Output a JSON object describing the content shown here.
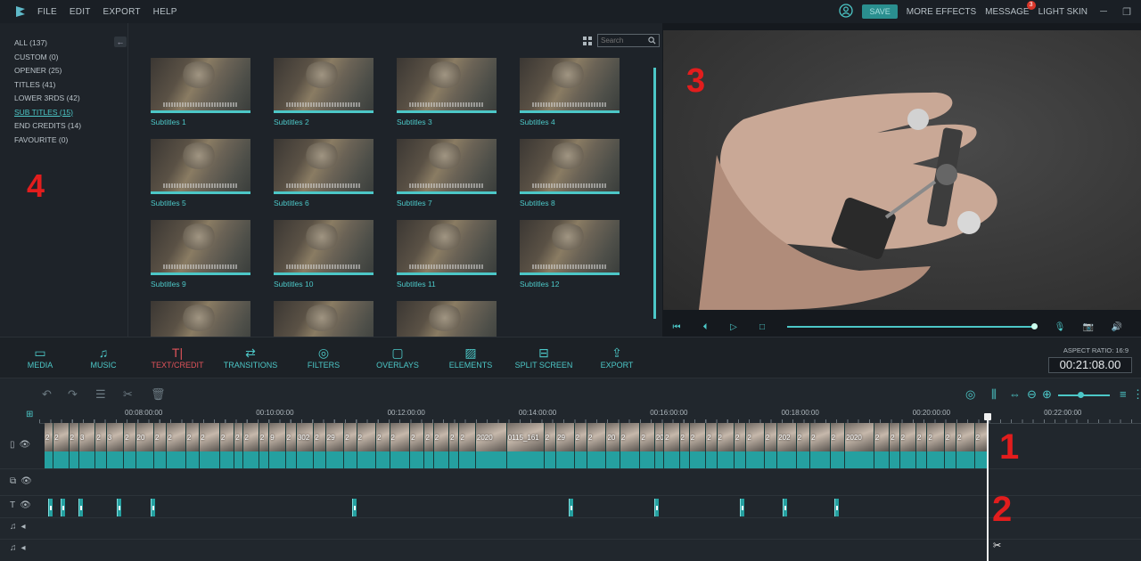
{
  "menu": {
    "file": "FILE",
    "edit": "EDIT",
    "export": "EXPORT",
    "help": "HELP"
  },
  "topbar": {
    "save": "SAVE",
    "more_effects": "MORE EFFECTS",
    "message": "MESSAGE",
    "message_count": "3",
    "light_skin": "LIGHT SKIN"
  },
  "categories": [
    {
      "label": "ALL (137)"
    },
    {
      "label": "CUSTOM (0)"
    },
    {
      "label": "OPENER (25)"
    },
    {
      "label": "TITLES (41)"
    },
    {
      "label": "LOWER 3RDS (42)"
    },
    {
      "label": "SUB TITLES (15)",
      "active": true
    },
    {
      "label": "END CREDITS (14)"
    },
    {
      "label": "FAVOURITE (0)"
    }
  ],
  "library": {
    "search_placeholder": "Search",
    "tiles": [
      "Subtitles 1",
      "Subtitles 2",
      "Subtitles 3",
      "Subtitles 4",
      "Subtitles 5",
      "Subtitles 6",
      "Subtitles 7",
      "Subtitles 8",
      "Subtitles 9",
      "Subtitles 10",
      "Subtitles 11",
      "Subtitles 12",
      "",
      "",
      ""
    ]
  },
  "annotations": {
    "n1": "1",
    "n2": "2",
    "n3": "3",
    "n4": "4"
  },
  "toolbar": {
    "tools": [
      "MEDIA",
      "MUSIC",
      "TEXT/CREDIT",
      "TRANSITIONS",
      "FILTERS",
      "OVERLAYS",
      "ELEMENTS",
      "SPLIT SCREEN",
      "EXPORT"
    ],
    "active_tool": "TEXT/CREDIT",
    "aspect_ratio": "ASPECT RATIO: 16:9",
    "timecode": "00:21:08.00"
  },
  "ruler": [
    "00:08:00:00",
    "00:10:00:00",
    "00:12:00:00",
    "00:14:00:00",
    "00:16:00:00",
    "00:18:00:00",
    "00:20:00:00",
    "00:22:00:00"
  ],
  "video_clip_labels": [
    "2",
    "2",
    "2",
    "3",
    "2",
    "3",
    "2",
    "20",
    "2",
    "2",
    "2",
    "2",
    "2",
    "2",
    "2",
    "2",
    "9",
    "2",
    "302",
    "2",
    "29",
    "2",
    "2",
    "2",
    "2",
    "2",
    "2",
    "2",
    "2",
    "2",
    "2020",
    "0115_161",
    "2",
    "29",
    "2",
    "2",
    "20",
    "2",
    "2",
    "20",
    "2",
    "2",
    "2",
    "2",
    "2",
    "2",
    "2",
    "2",
    "202",
    "2",
    "2",
    "2",
    "2020",
    "2",
    "2",
    "2",
    "2",
    "2",
    "2",
    "2",
    "2"
  ],
  "colors": {
    "accent": "#4cc7c7",
    "active_tool": "#e0535a",
    "badge": "#d9362a",
    "annotation": "#e21d1d",
    "clip": "#25a0a0"
  }
}
